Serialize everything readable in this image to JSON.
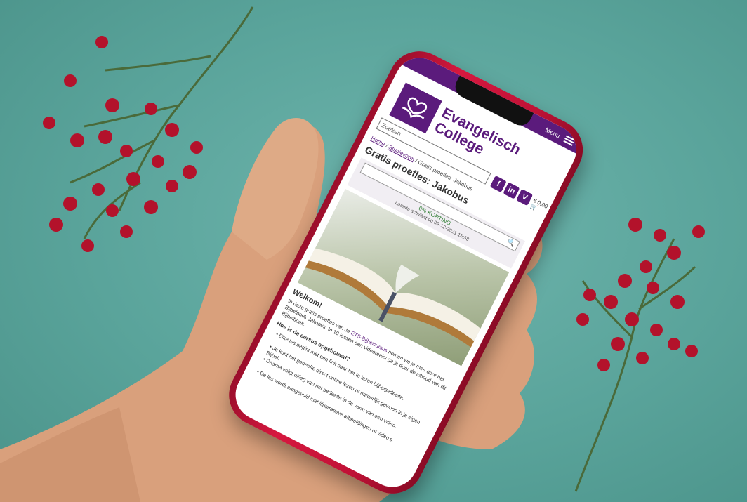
{
  "site": {
    "menu_label": "Menu",
    "logo_text_line1": "Evangelisch",
    "logo_text_line2": "College",
    "search_placeholder": "Zoeken",
    "social": [
      "f",
      "in",
      "V"
    ],
    "cart": "€ 0,00"
  },
  "breadcrumb": {
    "home": "Home",
    "sep": "/",
    "studies": "Studievorm",
    "current": "Gratis proefles: Jakobus"
  },
  "page": {
    "title": "Gratis proefles: Jakobus",
    "price": "0% KORTING",
    "updated": "Laatste activiteit op 09-12-2021 15:58",
    "welcome": "Welkom!",
    "intro_1": "In deze gratis proefles van de ",
    "intro_link": "ETS-Bijbelcursus",
    "intro_2": " nemen we je mee door het Bijbelboek Jakobus. In 10 lessen een videoreeks ga je door de inhoud van dit Bijbelboek.",
    "question": "Hoe is de cursus opgebouwd?",
    "bullets": [
      "Elke les begint met een link naar het te lezen bijbelgedeelte.",
      "Je kunt het gedeelte direct online lezen of natuurlijk gewoon in je eigen Bijbel.",
      "Daarna volgt uitleg van het gedeelte in de vorm van een video.",
      "De les wordt aangevuld met illustratieve afbeeldingen of video's."
    ]
  },
  "colors": {
    "brand": "#5b1b7c",
    "phone": "#c8143a",
    "background": "#5aa49b"
  }
}
